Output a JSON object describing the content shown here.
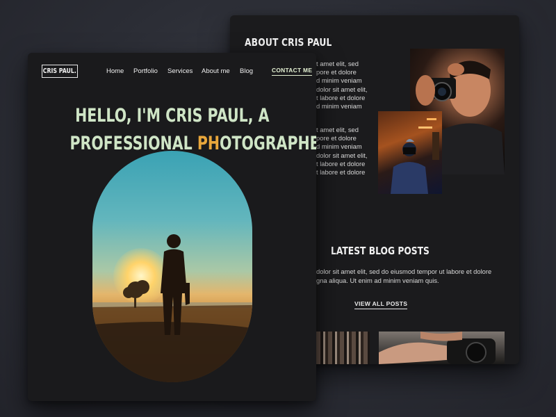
{
  "about": {
    "title": "ABOUT CRIS PAUL",
    "paragraph1": [
      "t amet elit, sed",
      "pore et dolore",
      "d minim veniam",
      "dolor sit amet elit,",
      "t labore et dolore",
      "d minim veniam"
    ],
    "paragraph2": [
      "t amet elit, sed",
      "pore et dolore",
      "d minim veniam",
      "dolor sit amet elit,",
      "t labore et dolore",
      "t labore et dolore"
    ]
  },
  "blog": {
    "title": "LATEST BLOG POSTS",
    "lines": [
      "dolor sit amet elit, sed do eiusmod tempor ut labore et dolore",
      "gna aliqua. Ut enim ad minim veniam quis."
    ],
    "view_all": "VIEW ALL POSTS"
  },
  "header": {
    "logo": "CRIS PAUL.",
    "nav": [
      "Home",
      "Portfolio",
      "Services",
      "About me",
      "Blog"
    ],
    "contact": "CONTACT ME"
  },
  "hero": {
    "line1": "HELLO, I'M CRIS PAUL, A",
    "line2_a": "PROFESSIONAL ",
    "line2_highlight": "PH",
    "line2_b": "OTOGRAPHER."
  },
  "colors": {
    "background": "#2b2d35",
    "card": "#1c1c1e",
    "headline": "#cfe5c6",
    "accent": "#e8a63b"
  }
}
